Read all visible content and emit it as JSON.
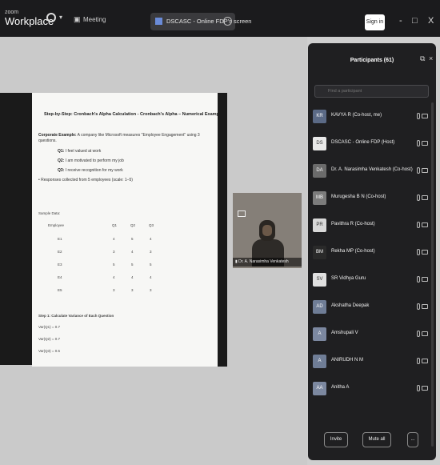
{
  "titlebar": {
    "brand_small": "zoom",
    "brand_large": "Workplace",
    "meeting_label": "Meeting",
    "share_tab_label": "DSCASC - Online FDP's screen",
    "signin_label": "Sign in",
    "minimize": "-",
    "restore": "□",
    "close": "X"
  },
  "slide": {
    "title": "Step-by-Step: Cronbach's Alpha Calculation - Cronbach's Alpha – Numerical Example",
    "intro_bold": "Corporate Example:",
    "intro_rest": "A company like Microsoft measures \"Employee Engagement\" using 3",
    "intro_line2": "questions.",
    "questions": [
      {
        "id": "Q1:",
        "text": "I feel valued at work"
      },
      {
        "id": "Q2:",
        "text": "I am motivated to perform my job"
      },
      {
        "id": "Q3:",
        "text": "I receive recognition for my work"
      }
    ],
    "responses_note": "• Responses collected from 5 employees (scale: 1–5)",
    "sample_label": "Sample Data:",
    "table_headers": [
      "Employee",
      "Q1",
      "Q2",
      "Q3"
    ],
    "table_rows": [
      [
        "E1",
        "4",
        "5",
        "4"
      ],
      [
        "E2",
        "3",
        "4",
        "3"
      ],
      [
        "E3",
        "5",
        "5",
        "5"
      ],
      [
        "E4",
        "4",
        "4",
        "4"
      ],
      [
        "E5",
        "3",
        "3",
        "3"
      ]
    ],
    "step1": "Step 1: Calculate Variance of Each Question",
    "variances": [
      "Var(Q1) = 0.7",
      "Var(Q2) = 0.7",
      "Var(Q3) = 0.5"
    ]
  },
  "video": {
    "name": "Dr. A. Narasimha Venkatesh"
  },
  "participants": {
    "title": "Participants (61)",
    "search_placeholder": "Find a participant",
    "list": [
      {
        "initials": "KR",
        "name": "KAVYA R (Co-host, me)",
        "color": "#5b6a86"
      },
      {
        "initials": "DS",
        "name": "DSCASC - Online FDP (Host)",
        "color": "#e8e8e8"
      },
      {
        "initials": "DA",
        "name": "Dr. A. Narasimha Venkatesh (Co-host)",
        "color": "#6b6b6b"
      },
      {
        "initials": "MB",
        "name": "Murugesha B N (Co-host)",
        "color": "#7c7c7c"
      },
      {
        "initials": "PR",
        "name": "Pavithra R (Co-host)",
        "color": "#d8d8d8"
      },
      {
        "initials": "BM",
        "name": "Rekha MP (Co-host)",
        "color": "#2a2a2a"
      },
      {
        "initials": "SV",
        "name": "SR Vidhya Guru",
        "color": "#e0e0e0"
      },
      {
        "initials": "AD",
        "name": "Akshatha Deepak",
        "color": "#6f7d96"
      },
      {
        "initials": "A",
        "name": "Amshupali V",
        "color": "#7c88a0"
      },
      {
        "initials": "A",
        "name": "ANIRUDH N M",
        "color": "#6f7d96"
      },
      {
        "initials": "AA",
        "name": "Anitha A",
        "color": "#7c88a0"
      }
    ],
    "invite_label": "Invite",
    "mute_all_label": "Mute all",
    "more_label": "..."
  }
}
